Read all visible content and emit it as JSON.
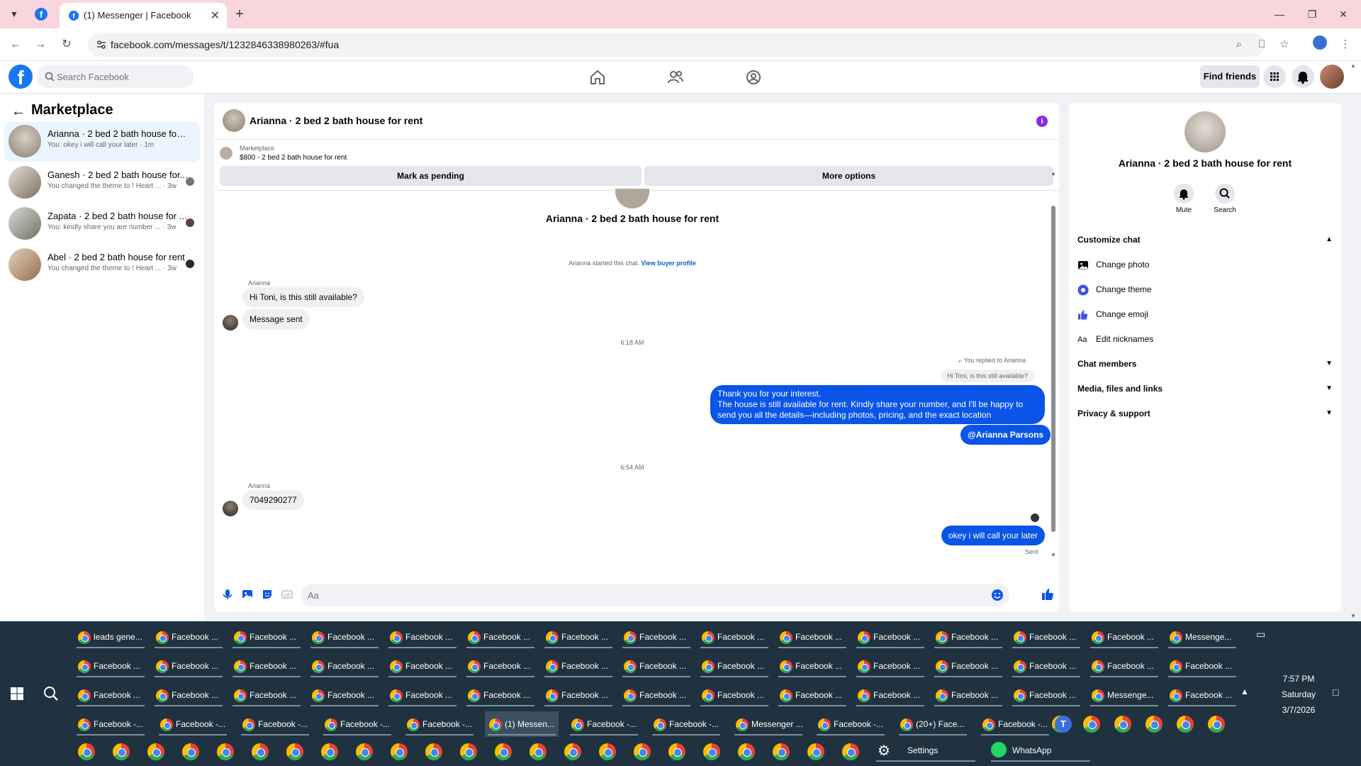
{
  "browser": {
    "active_tab_title": "(1) Messenger | Facebook",
    "url": "facebook.com/messages/t/1232846338980263/#fua"
  },
  "fb": {
    "search_placeholder": "Search Facebook",
    "find_friends": "Find friends",
    "brand_color": "#1877f2"
  },
  "left": {
    "title": "Marketplace",
    "conversations": [
      {
        "name": "Arianna · 2 bed 2 bath house for r...",
        "preview": "You: okey i will call your later · 1m"
      },
      {
        "name": "Ganesh · 2 bed 2 bath house for...",
        "preview": "You changed the theme to ! Heart ... · 3w"
      },
      {
        "name": "Zapata · 2 bed 2 bath house for ...",
        "preview": "You: kindly share you are number ... · 3w"
      },
      {
        "name": "Abel · 2 bed 2 bath house for rent",
        "preview": "You changed the theme to ! Heart ... · 3w"
      }
    ]
  },
  "chat": {
    "title": "Arianna · 2 bed 2 bath house for rent",
    "info_glyph": "i",
    "listing_source": "Marketplace",
    "listing_price": "$800 - 2 bed 2 bath house for rent",
    "mark_pending": "Mark as pending",
    "more_options": "More options",
    "start_title": "Arianna · 2 bed 2 bath house for rent",
    "system_text": "Arianna started this chat.",
    "view_buyer": "View buyer profile",
    "sender1": "Arianna",
    "msg1": "Hi Toni, is this still available?",
    "msg2": "Message sent",
    "time1": "6:18 AM",
    "reply_note": "You replied to Arianna",
    "reply_quote": "Hi Toni, is this still available?",
    "out1_line1": "Thank you for your interest.",
    "out1_line2": "The house is still available for rent. Kindly share your number, and I'll be happy to",
    "out1_line3": "send you all the details—including photos, pricing, and the exact location",
    "mention": "@Arianna Parsons",
    "time2": "6:54 AM",
    "sender2": "Arianna",
    "msg3": "7049290277",
    "out2": "okey i will call your later",
    "sent_label": "Sent",
    "composer_placeholder": "Aa",
    "outgoing_color": "#0a55e8"
  },
  "right": {
    "name": "Arianna · 2 bed 2 bath house for rent",
    "mute": "Mute",
    "search": "Search",
    "customize_chat": "Customize chat",
    "change_photo": "Change photo",
    "change_theme": "Change theme",
    "change_emoji": "Change emoji",
    "edit_nicknames": "Edit nicknames",
    "nicknames_glyph": "Aa",
    "chat_members": "Chat members",
    "media": "Media, files and links",
    "privacy": "Privacy & support"
  },
  "taskbar": {
    "row1": [
      "leads gene...",
      "Facebook ...",
      "Facebook ...",
      "Facebook ...",
      "Facebook ...",
      "Facebook ...",
      "Facebook ...",
      "Facebook ...",
      "Facebook ...",
      "Facebook ...",
      "Facebook ...",
      "Facebook ...",
      "Facebook ...",
      "Facebook ...",
      "Messenge..."
    ],
    "row2": [
      "Facebook ...",
      "Facebook ...",
      "Facebook ...",
      "Facebook ...",
      "Facebook ...",
      "Facebook ...",
      "Facebook ...",
      "Facebook ...",
      "Facebook ...",
      "Facebook ...",
      "Facebook ...",
      "Facebook ...",
      "Facebook ...",
      "Facebook ...",
      "Facebook ..."
    ],
    "row3": [
      "Facebook ...",
      "Facebook ...",
      "Facebook ...",
      "Facebook ...",
      "Facebook ...",
      "Facebook ...",
      "Facebook ...",
      "Facebook ...",
      "Facebook ...",
      "Facebook ...",
      "Facebook ...",
      "Facebook ...",
      "Facebook ...",
      "Messenge...",
      "Facebook ..."
    ],
    "row4": [
      "Facebook -...",
      "Facebook -...",
      "Facebook -...",
      "Facebook -...",
      "Facebook -...",
      "(1) Messen...",
      "Facebook -...",
      "Facebook -...",
      "Messenger ...",
      "Facebook -...",
      "(20+) Face...",
      "Facebook -..."
    ],
    "settings": "Settings",
    "whatsapp": "WhatsApp",
    "time": "7:57 PM",
    "day": "Saturday",
    "date": "3/7/2026"
  }
}
